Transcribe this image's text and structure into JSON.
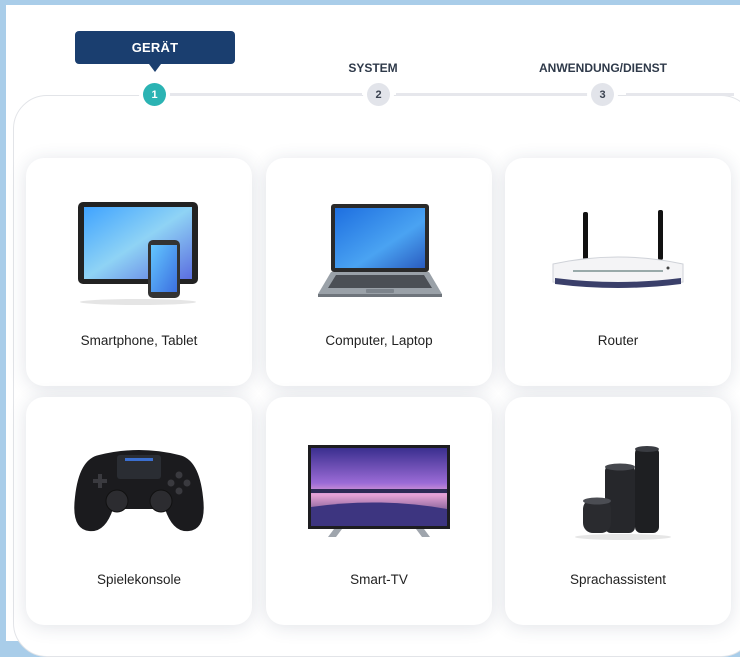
{
  "stepper": {
    "tooltip": "GERÄT",
    "steps": [
      {
        "number": "1",
        "label": "GERÄT",
        "active": true
      },
      {
        "number": "2",
        "label": "SYSTEM",
        "active": false
      },
      {
        "number": "3",
        "label": "ANWENDUNG/DIENST",
        "active": false
      }
    ]
  },
  "devices": [
    {
      "label": "Smartphone, Tablet",
      "icon": "tablet-phone-icon"
    },
    {
      "label": "Computer, Laptop",
      "icon": "laptop-icon"
    },
    {
      "label": "Router",
      "icon": "router-icon"
    },
    {
      "label": "Spielekonsole",
      "icon": "gamepad-icon"
    },
    {
      "label": "Smart-TV",
      "icon": "tv-icon"
    },
    {
      "label": "Sprachassistent",
      "icon": "smart-speaker-icon"
    }
  ],
  "colors": {
    "active_step": "#2bb3b3",
    "tooltip_bg": "#1a3e6f",
    "frame": "#a9cde9"
  }
}
